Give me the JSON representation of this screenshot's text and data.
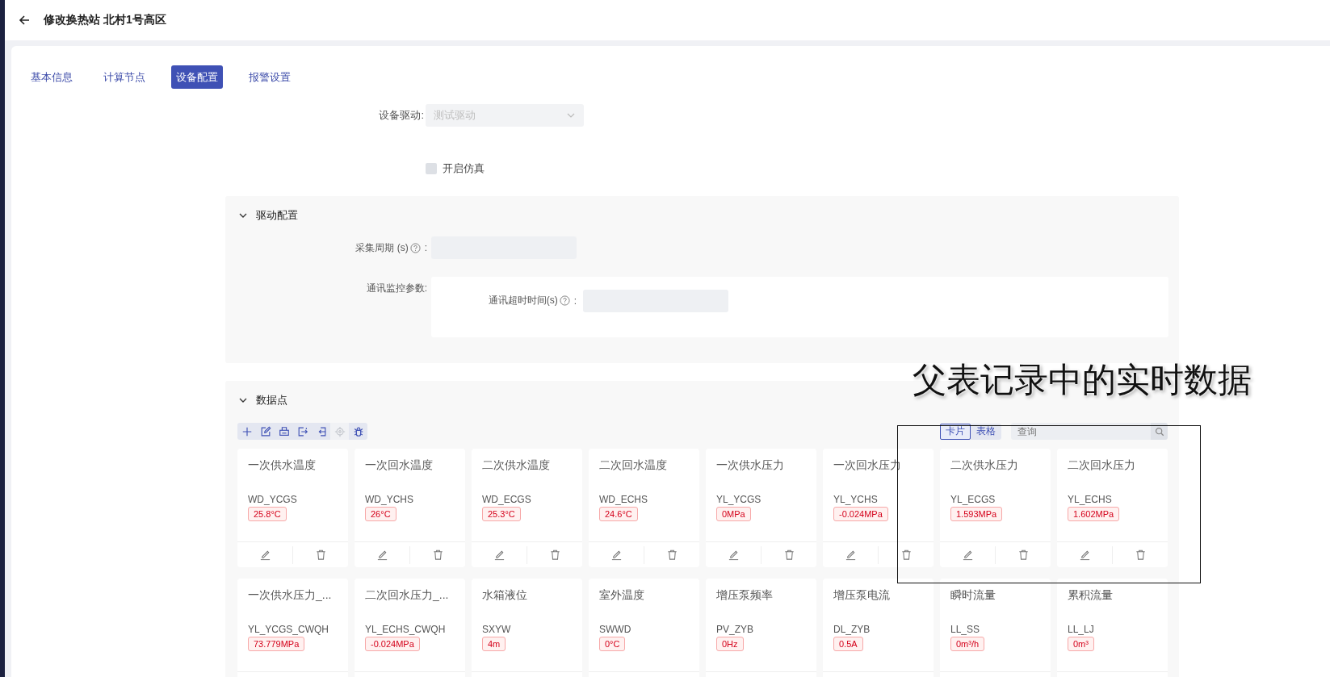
{
  "header": {
    "title": "修改换热站 北村1号高区"
  },
  "tabs": [
    {
      "label": "基本信息",
      "selected": false
    },
    {
      "label": "计算节点",
      "selected": false
    },
    {
      "label": "设备配置",
      "selected": true
    },
    {
      "label": "报警设置",
      "selected": false
    }
  ],
  "device_driver": {
    "label": "设备驱动:",
    "value": "测试驱动",
    "disabled": true
  },
  "simulation": {
    "label": "开启仿真",
    "checked": false
  },
  "driver_panel": {
    "title": "驱动配置",
    "expanded": true,
    "period": {
      "label": "采集周期 (s)",
      "colon": ":"
    },
    "monitor": {
      "label": "通讯监控参数:",
      "timeout_label": "通讯超时时间(s)",
      "colon": ":"
    }
  },
  "data_panel": {
    "title": "数据点",
    "expanded": true,
    "toolbar": [
      {
        "kind": "add",
        "disabled": false
      },
      {
        "kind": "edit",
        "disabled": false
      },
      {
        "kind": "print",
        "disabled": false
      },
      {
        "kind": "export",
        "disabled": false
      },
      {
        "kind": "import",
        "disabled": false
      },
      {
        "kind": "locate",
        "disabled": true
      },
      {
        "kind": "debug",
        "disabled": false
      }
    ],
    "views": [
      {
        "label": "卡片",
        "selected": true
      },
      {
        "label": "表格",
        "selected": false
      }
    ],
    "search": {
      "placeholder": "查询"
    },
    "cards": [
      {
        "name": "一次供水温度",
        "code": "WD_YCGS",
        "value": "25.8°C"
      },
      {
        "name": "一次回水温度",
        "code": "WD_YCHS",
        "value": "26°C"
      },
      {
        "name": "二次供水温度",
        "code": "WD_ECGS",
        "value": "25.3°C"
      },
      {
        "name": "二次回水温度",
        "code": "WD_ECHS",
        "value": "24.6°C"
      },
      {
        "name": "一次供水压力",
        "code": "YL_YCGS",
        "value": "0MPa"
      },
      {
        "name": "一次回水压力",
        "code": "YL_YCHS",
        "value": "-0.024MPa"
      },
      {
        "name": "二次供水压力",
        "code": "YL_ECGS",
        "value": "1.593MPa"
      },
      {
        "name": "二次回水压力",
        "code": "YL_ECHS",
        "value": "1.602MPa"
      },
      {
        "name": "一次供水压力_...",
        "code": "YL_YCGS_CWQH",
        "value": "73.779MPa"
      },
      {
        "name": "二次回水压力_...",
        "code": "YL_ECHS_CWQH",
        "value": "-0.024MPa"
      },
      {
        "name": "水箱液位",
        "code": "SXYW",
        "value": "4m"
      },
      {
        "name": "室外温度",
        "code": "SWWD",
        "value": "0°C"
      },
      {
        "name": "增压泵频率",
        "code": "PV_ZYB",
        "value": "0Hz"
      },
      {
        "name": "增压泵电流",
        "code": "DL_ZYB",
        "value": "0.5A"
      },
      {
        "name": "瞬时流量",
        "code": "LL_SS",
        "value": "0m³/h"
      },
      {
        "name": "累积流量",
        "code": "LL_LJ",
        "value": "0m³"
      }
    ]
  },
  "annotation": {
    "text": "父表记录中的实时数据"
  }
}
